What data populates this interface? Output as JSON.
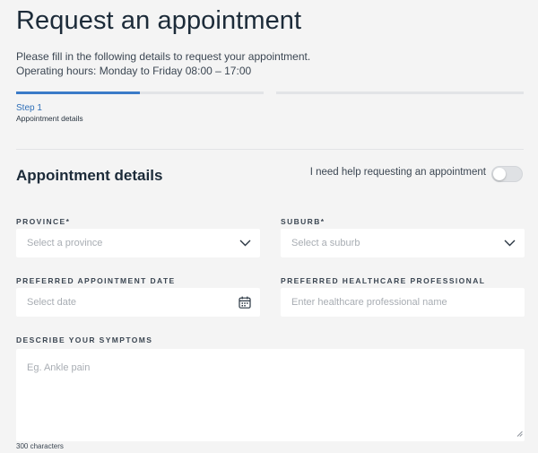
{
  "header": {
    "title": "Request an appointment",
    "intro_line1": "Please fill in the following details to request your appointment.",
    "intro_line2": "Operating hours: Monday to Friday 08:00 – 17:00"
  },
  "stepper": {
    "step_title": "Step 1",
    "step_subtitle": "Appointment details",
    "step_progress_fraction": 0.5,
    "accent_color": "#3a7bc8"
  },
  "section": {
    "title": "Appointment details",
    "help_toggle_label": "I need help requesting an appointment",
    "help_toggle_on": false
  },
  "fields": {
    "province": {
      "label": "PROVINCE*",
      "placeholder": "Select a province",
      "icon": "chevron-down-icon"
    },
    "suburb": {
      "label": "SUBURB*",
      "placeholder": "Select a suburb",
      "icon": "chevron-down-icon"
    },
    "date": {
      "label": "PREFERRED APPOINTMENT DATE",
      "placeholder": "Select date",
      "icon": "calendar-icon"
    },
    "professional": {
      "label": "PREFERRED HEALTHCARE PROFESSIONAL",
      "placeholder": "Enter healthcare professional name"
    },
    "symptoms": {
      "label": "DESCRIBE YOUR SYMPTOMS",
      "placeholder": "Eg. Ankle pain",
      "char_limit": "300 characters"
    }
  }
}
